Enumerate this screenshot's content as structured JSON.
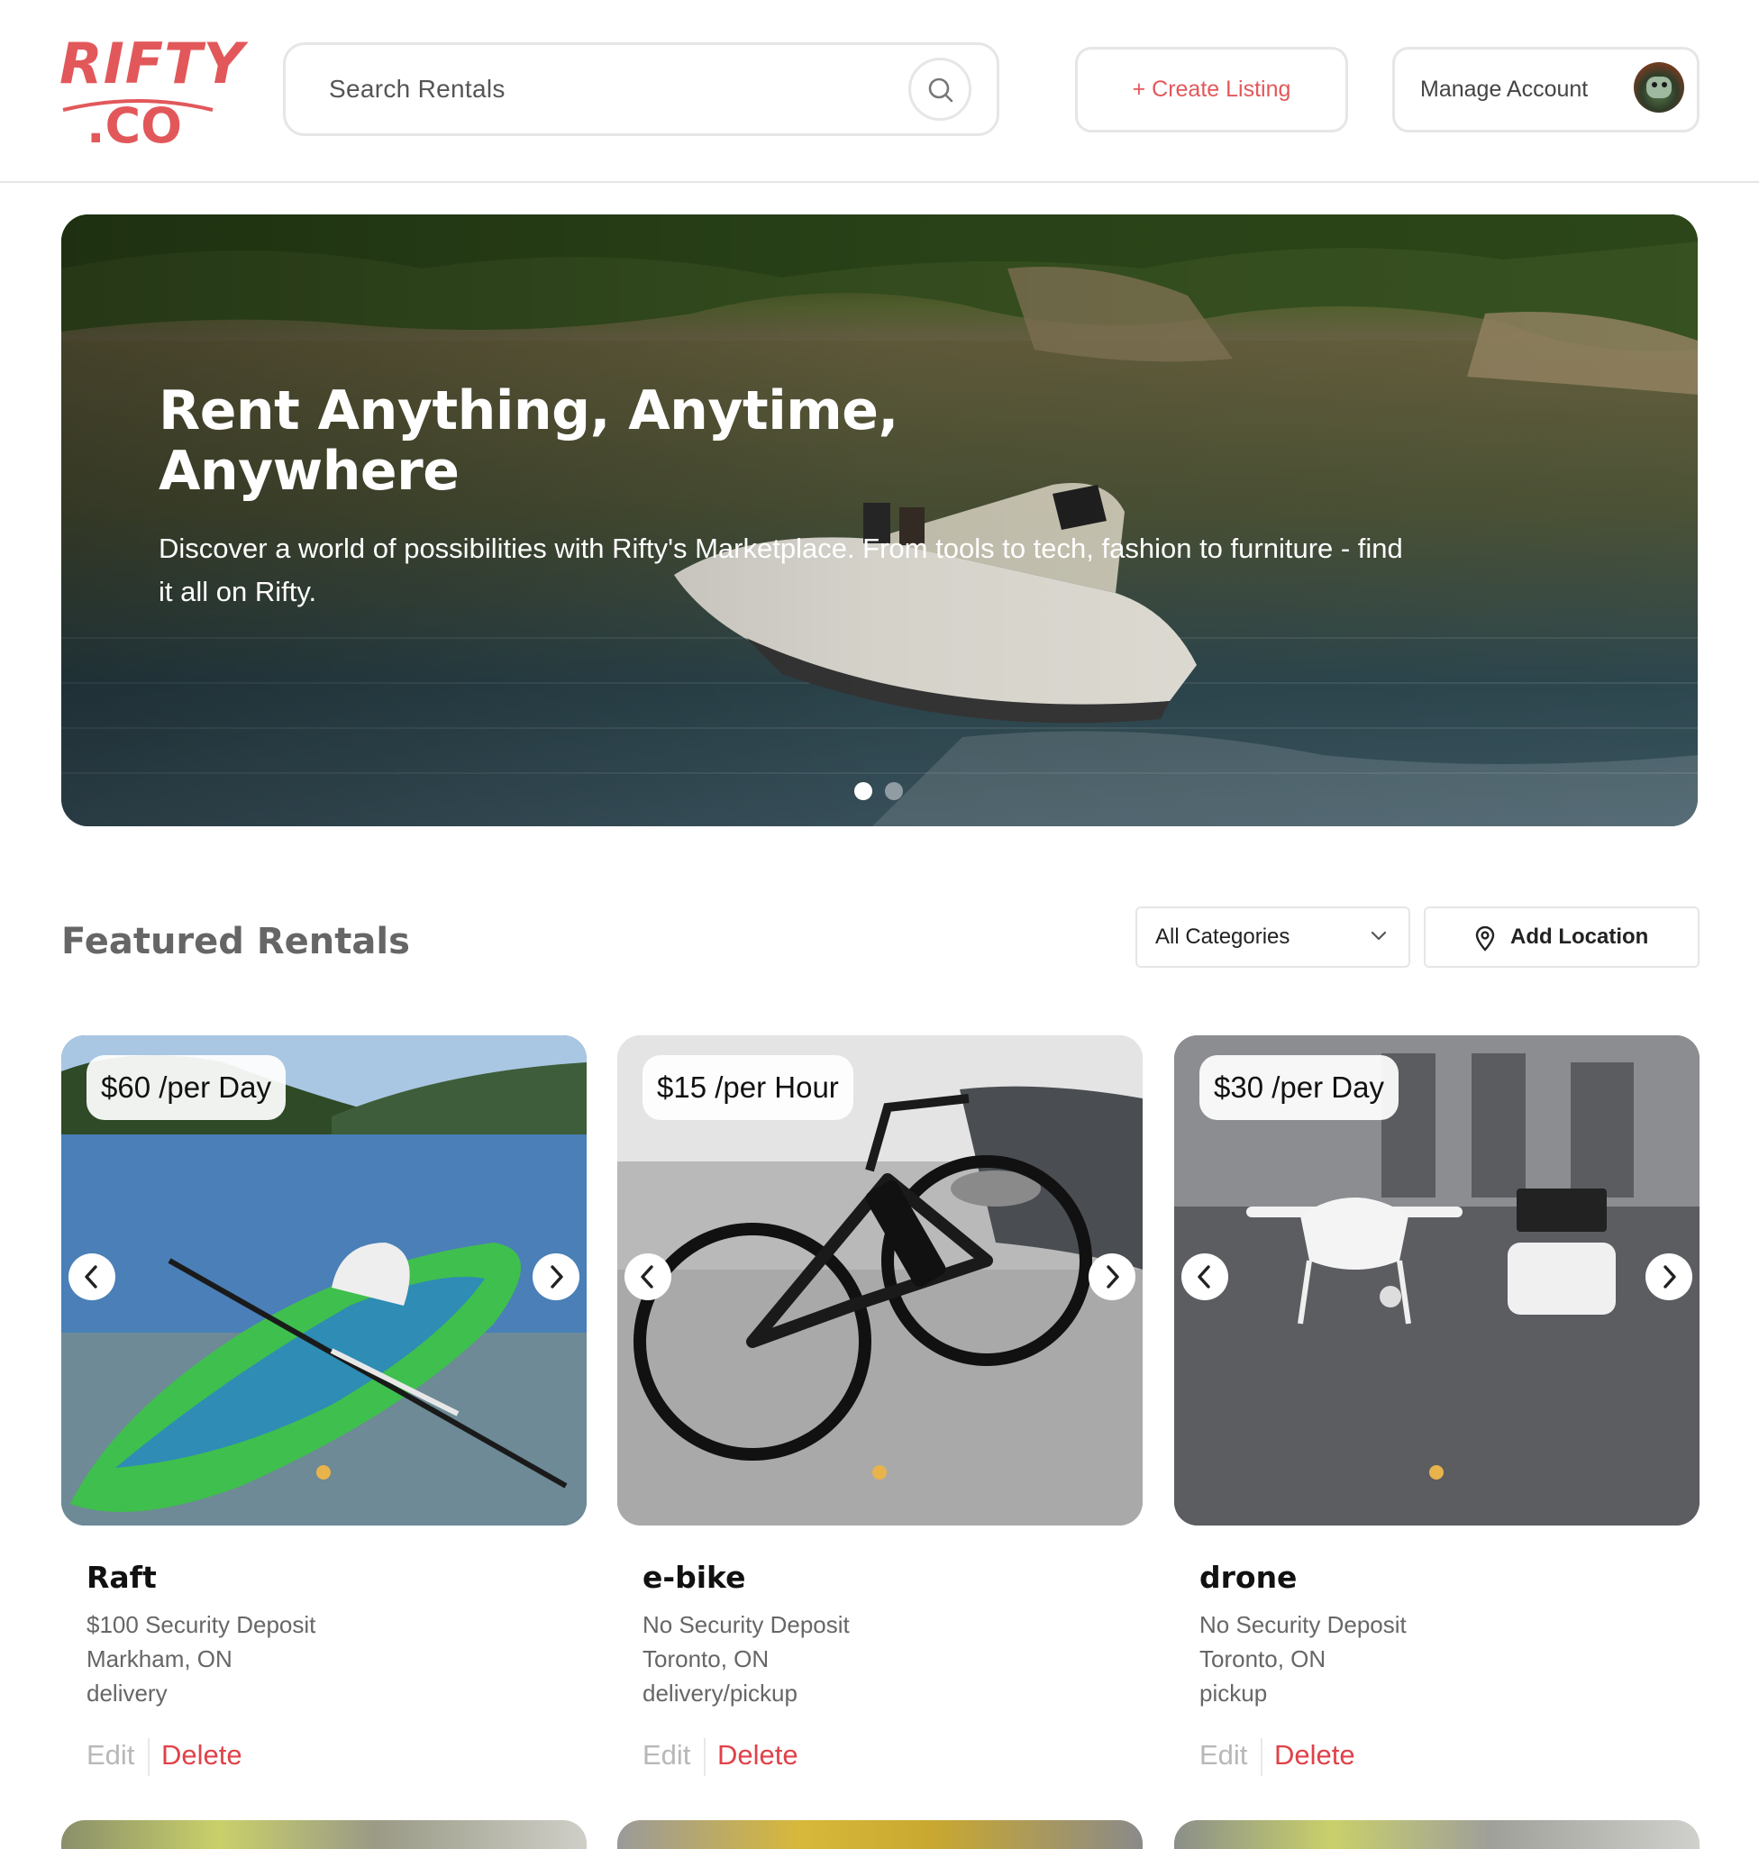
{
  "header": {
    "logo_top": "RIFTY",
    "logo_bottom": ".CO",
    "search": {
      "placeholder": "Search Rentals"
    },
    "create_listing_label": "+ Create Listing",
    "manage_account_label": "Manage Account"
  },
  "hero": {
    "title": "Rent Anything, Anytime, Anywhere",
    "subtitle": "Discover a world of possibilities with Rifty's Marketplace. From tools to tech, fashion to furniture - find it all on Rifty.",
    "slide_count": 2,
    "active_slide": 1
  },
  "featured": {
    "title": "Featured Rentals",
    "category_select": "All Categories",
    "add_location_label": "Add Location"
  },
  "listings": [
    {
      "price": "$60 /per Day",
      "name": "Raft",
      "deposit": "$100 Security Deposit",
      "location": "Markham, ON",
      "fulfillment": "delivery",
      "edit_label": "Edit",
      "delete_label": "Delete"
    },
    {
      "price": "$15 /per Hour",
      "name": "e-bike",
      "deposit": "No Security Deposit",
      "location": "Toronto, ON",
      "fulfillment": "delivery/pickup",
      "edit_label": "Edit",
      "delete_label": "Delete"
    },
    {
      "price": "$30 /per Day",
      "name": "drone",
      "deposit": "No Security Deposit",
      "location": "Toronto, ON",
      "fulfillment": "pickup",
      "edit_label": "Edit",
      "delete_label": "Delete"
    }
  ],
  "colors": {
    "brand": "#e2585a",
    "delete": "#e0424a",
    "border": "#e6e6e6",
    "image_dot": "#e9b34c"
  },
  "icons": [
    "search-icon",
    "chevron-down-icon",
    "location-pin-icon",
    "chevron-left-icon",
    "chevron-right-icon"
  ]
}
